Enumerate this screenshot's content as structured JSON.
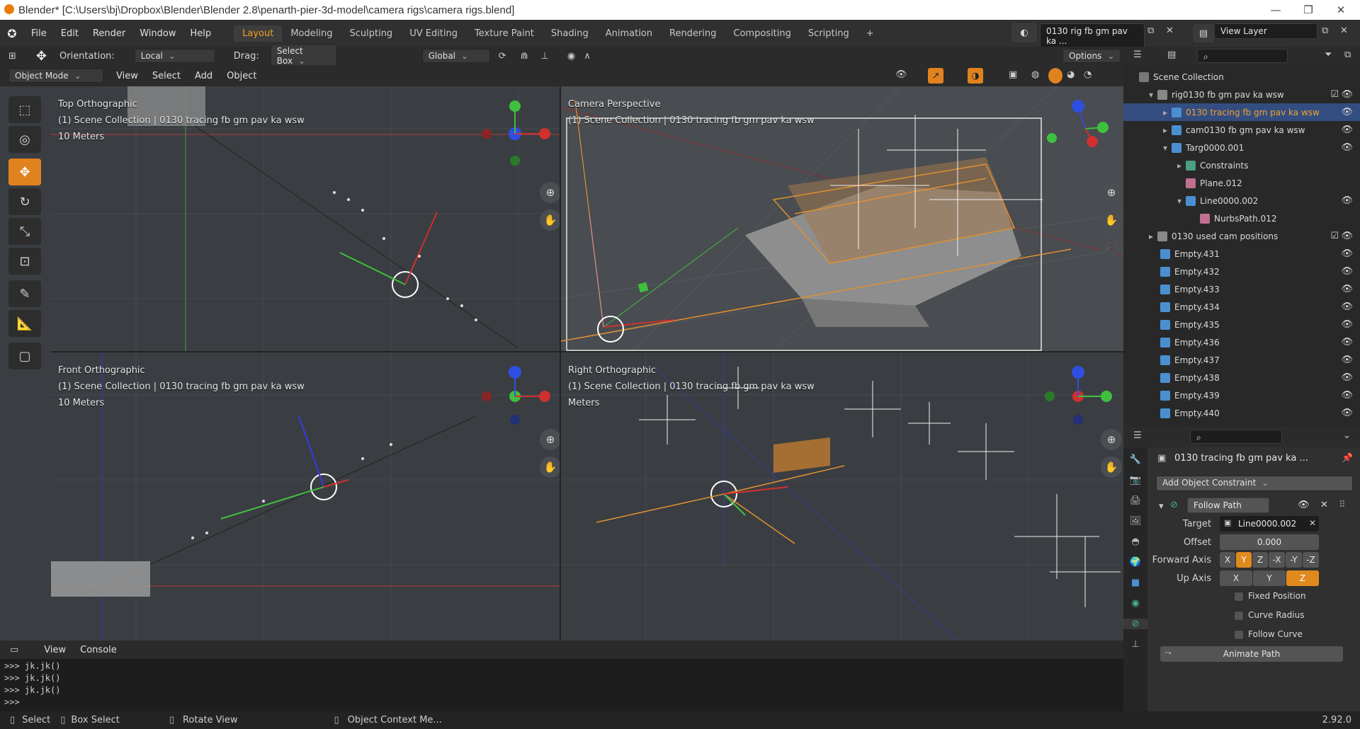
{
  "titlebar": {
    "title": "Blender* [C:\\Users\\bj\\Dropbox\\Blender\\Blender 2.8\\penarth-pier-3d-model\\camera rigs\\camera rigs.blend]"
  },
  "menu": {
    "items": [
      "File",
      "Edit",
      "Render",
      "Window",
      "Help"
    ],
    "workspaces": [
      "Layout",
      "Modeling",
      "Sculpting",
      "UV Editing",
      "Texture Paint",
      "Shading",
      "Animation",
      "Rendering",
      "Compositing",
      "Scripting"
    ],
    "active_workspace": "Layout",
    "add_workspace": "+",
    "scene_name": "0130 rig fb gm pav ka ...",
    "view_layer": "View Layer"
  },
  "header": {
    "orientation_label": "Orientation:",
    "orientation_value": "Local",
    "drag_label": "Drag:",
    "drag_value": "Select Box",
    "transform_orientation": "Global",
    "options_label": "Options"
  },
  "viewport_header": {
    "mode": "Object Mode",
    "menus": [
      "View",
      "Select",
      "Add",
      "Object"
    ]
  },
  "viewports": {
    "top": {
      "name": "Top Orthographic",
      "collection": "(1) Scene Collection | 0130 tracing fb gm pav ka wsw",
      "scale": "10 Meters"
    },
    "camera": {
      "name": "Camera Perspective",
      "collection": "(1) Scene Collection | 0130 tracing fb gm pav ka wsw"
    },
    "front": {
      "name": "Front Orthographic",
      "collection": "(1) Scene Collection | 0130 tracing fb gm pav ka wsw",
      "scale": "10 Meters"
    },
    "right": {
      "name": "Right Orthographic",
      "collection": "(1) Scene Collection | 0130 tracing fb gm pav ka wsw",
      "scale": "Meters"
    }
  },
  "outliner": {
    "root": "Scene Collection",
    "rows": [
      {
        "label": "rig0130 fb gm pav ka wsw",
        "indent": 1,
        "icon": "collection-icon"
      },
      {
        "label": "0130 tracing fb gm pav ka wsw",
        "indent": 2,
        "icon": "object-icon",
        "selected": true
      },
      {
        "label": "cam0130 fb gm pav ka wsw",
        "indent": 2,
        "icon": "camera-icon"
      },
      {
        "label": "Targ0000.001",
        "indent": 2,
        "icon": "cone-icon"
      },
      {
        "label": "Constraints",
        "indent": 3,
        "icon": "constraint-icon"
      },
      {
        "label": "Plane.012",
        "indent": 3,
        "icon": "mesh-icon"
      },
      {
        "label": "Line0000.002",
        "indent": 3,
        "icon": "curve-icon"
      },
      {
        "label": "NurbsPath.012",
        "indent": 4,
        "icon": "curve-data-icon"
      },
      {
        "label": "0130 used cam positions",
        "indent": 1,
        "icon": "collection-icon"
      },
      {
        "label": "Empty.431",
        "indent": 1,
        "icon": "empty-icon"
      },
      {
        "label": "Empty.432",
        "indent": 1,
        "icon": "empty-icon"
      },
      {
        "label": "Empty.433",
        "indent": 1,
        "icon": "empty-icon"
      },
      {
        "label": "Empty.434",
        "indent": 1,
        "icon": "empty-icon"
      },
      {
        "label": "Empty.435",
        "indent": 1,
        "icon": "empty-icon"
      },
      {
        "label": "Empty.436",
        "indent": 1,
        "icon": "empty-icon"
      },
      {
        "label": "Empty.437",
        "indent": 1,
        "icon": "empty-icon"
      },
      {
        "label": "Empty.438",
        "indent": 1,
        "icon": "empty-icon"
      },
      {
        "label": "Empty.439",
        "indent": 1,
        "icon": "empty-icon"
      },
      {
        "label": "Empty.440",
        "indent": 1,
        "icon": "empty-icon"
      }
    ]
  },
  "properties": {
    "object_name": "0130 tracing fb gm pav ka ...",
    "add_constraint": "Add Object Constraint",
    "constraint_name": "Follow Path",
    "target_label": "Target",
    "target_value": "Line0000.002",
    "offset_label": "Offset",
    "offset_value": "0.000",
    "forward_axis_label": "Forward Axis",
    "forward_axes": [
      "X",
      "Y",
      "Z",
      "-X",
      "-Y",
      "-Z"
    ],
    "forward_active": "Y",
    "up_axis_label": "Up Axis",
    "up_axes": [
      "X",
      "Y",
      "Z"
    ],
    "up_active": "Z",
    "fixed_position": "Fixed Position",
    "curve_radius": "Curve Radius",
    "follow_curve": "Follow Curve",
    "animate_path": "Animate Path"
  },
  "console": {
    "menus": [
      "View",
      "Console"
    ],
    "lines": [
      ">>> jk.jk()",
      ">>> jk.jk()",
      ">>> jk.jk()",
      ">>> "
    ]
  },
  "statusbar": {
    "select": "Select",
    "box_select": "Box Select",
    "rotate_view": "Rotate View",
    "context_menu": "Object Context Me...",
    "version": "2.92.0"
  },
  "colors": {
    "accent": "#e0821e",
    "selection": "#334d80",
    "axis_x": "#d03030",
    "axis_y": "#3fbf3f",
    "axis_z": "#2f4fe0"
  }
}
